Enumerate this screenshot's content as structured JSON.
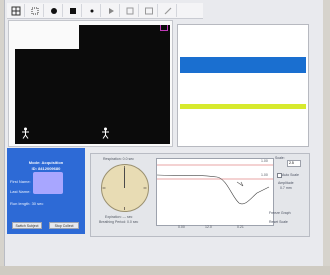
{
  "toolbar": {
    "buttons": [
      "grid-icon",
      "select-icon",
      "record-icon",
      "stop-icon",
      "dot-icon",
      "play-icon",
      "save-icon",
      "window-icon",
      "pen-icon"
    ]
  },
  "colors": {
    "info_panel": "#2d6ad6",
    "stripe_blue": "#1a6fd0",
    "stripe_yellow": "#d7ea2e",
    "camera_bg": "#0b0b0b",
    "gauge_face": "#e8dcb4"
  },
  "info": {
    "mode": "Mode: Acquisition",
    "id": "ID: 8412009680",
    "first_name_label": "First Name:",
    "last_name_label": "Last Name:",
    "run_length": "Run length:  30 sec",
    "button_left": "Switch Subject",
    "button_right": "Stop Collect"
  },
  "dash": {
    "gauge_label": "Respiration: 0.0 sec",
    "gauge_sub1": "Expiration: --- sec",
    "gauge_sub2": "Breathing Period: 0.0 sec",
    "value_top": "1.00",
    "value_mid": "1.00",
    "scale_label": "Scale:",
    "scale_value": "2.5",
    "auto_scale": "Auto Scale",
    "amplitude_label": "Amplitude",
    "amplitude_value": "0.7 mm",
    "x_ticks": [
      "0.00",
      "12.0",
      "0.21"
    ],
    "freeze_label": "Freeze Graph",
    "reset_label": "Reset Scale"
  }
}
